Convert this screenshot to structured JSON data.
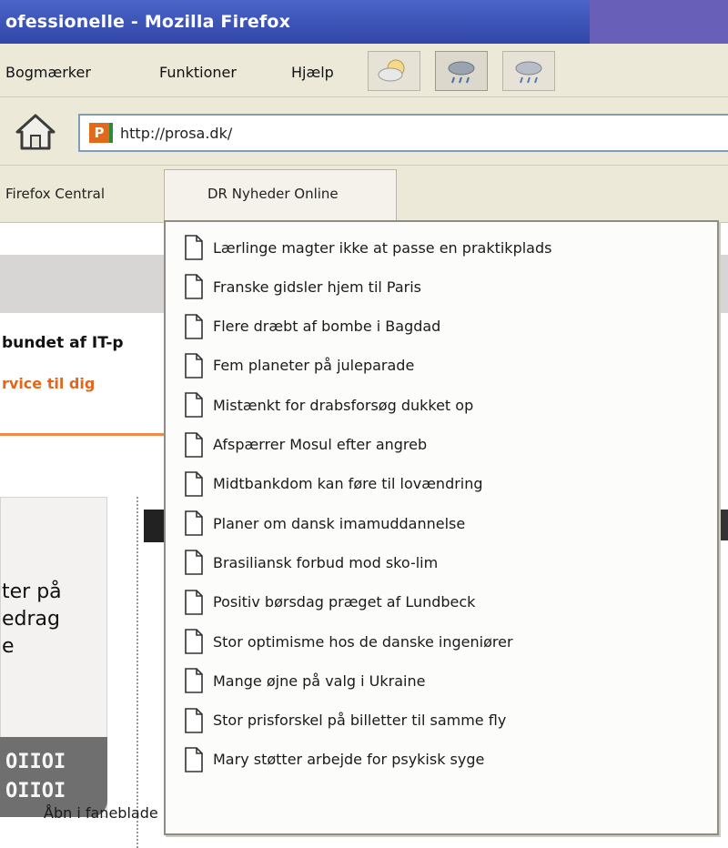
{
  "window": {
    "title": "ofessionelle - Mozilla Firefox"
  },
  "menu": {
    "items": [
      {
        "label": "Bogmærker"
      },
      {
        "label": "Funktioner"
      },
      {
        "label": "Hjælp"
      }
    ]
  },
  "toolbar": {
    "buttons": [
      {
        "icon": "cloud-weather-icon"
      },
      {
        "icon": "rain-weather-icon"
      },
      {
        "icon": "rain-weather-icon"
      }
    ]
  },
  "navigation": {
    "home_icon": "home-icon",
    "favicon_letter": "P",
    "url": "http://prosa.dk/"
  },
  "bookmarks": {
    "items": [
      {
        "label": "Firefox Central"
      },
      {
        "label": "DR Nyheder Online"
      }
    ]
  },
  "page": {
    "bold_text": "bundet af IT-p",
    "orange_text": "rvice til dig",
    "card_lines": [
      "ter på",
      "edrag",
      "e"
    ],
    "logo_lines": [
      "OIIOI",
      "OIIOI"
    ]
  },
  "dropdown": {
    "items": [
      "Lærlinge magter ikke at passe en praktikplads",
      "Franske gidsler hjem til Paris",
      "Flere dræbt af bombe i Bagdad",
      "Fem planeter på juleparade",
      "Mistænkt for drabsforsøg dukket op",
      "Afspærrer Mosul efter angreb",
      "Midtbankdom kan føre til lovændring",
      "Planer om dansk imamuddannelse",
      "Brasiliansk forbud mod sko-lim",
      "Positiv børsdag præget af Lundbeck",
      "Stor optimisme hos de danske ingeniører",
      "Mange øjne på valg i Ukraine",
      "Stor prisforskel på billetter til samme fly",
      "Mary støtter arbejde for psykisk syge"
    ],
    "open_in_tabs": "Åbn i faneblade"
  },
  "colors": {
    "titlebar": "#3a52b8",
    "chrome": "#ece9d8",
    "accent_orange": "#e2671c"
  }
}
